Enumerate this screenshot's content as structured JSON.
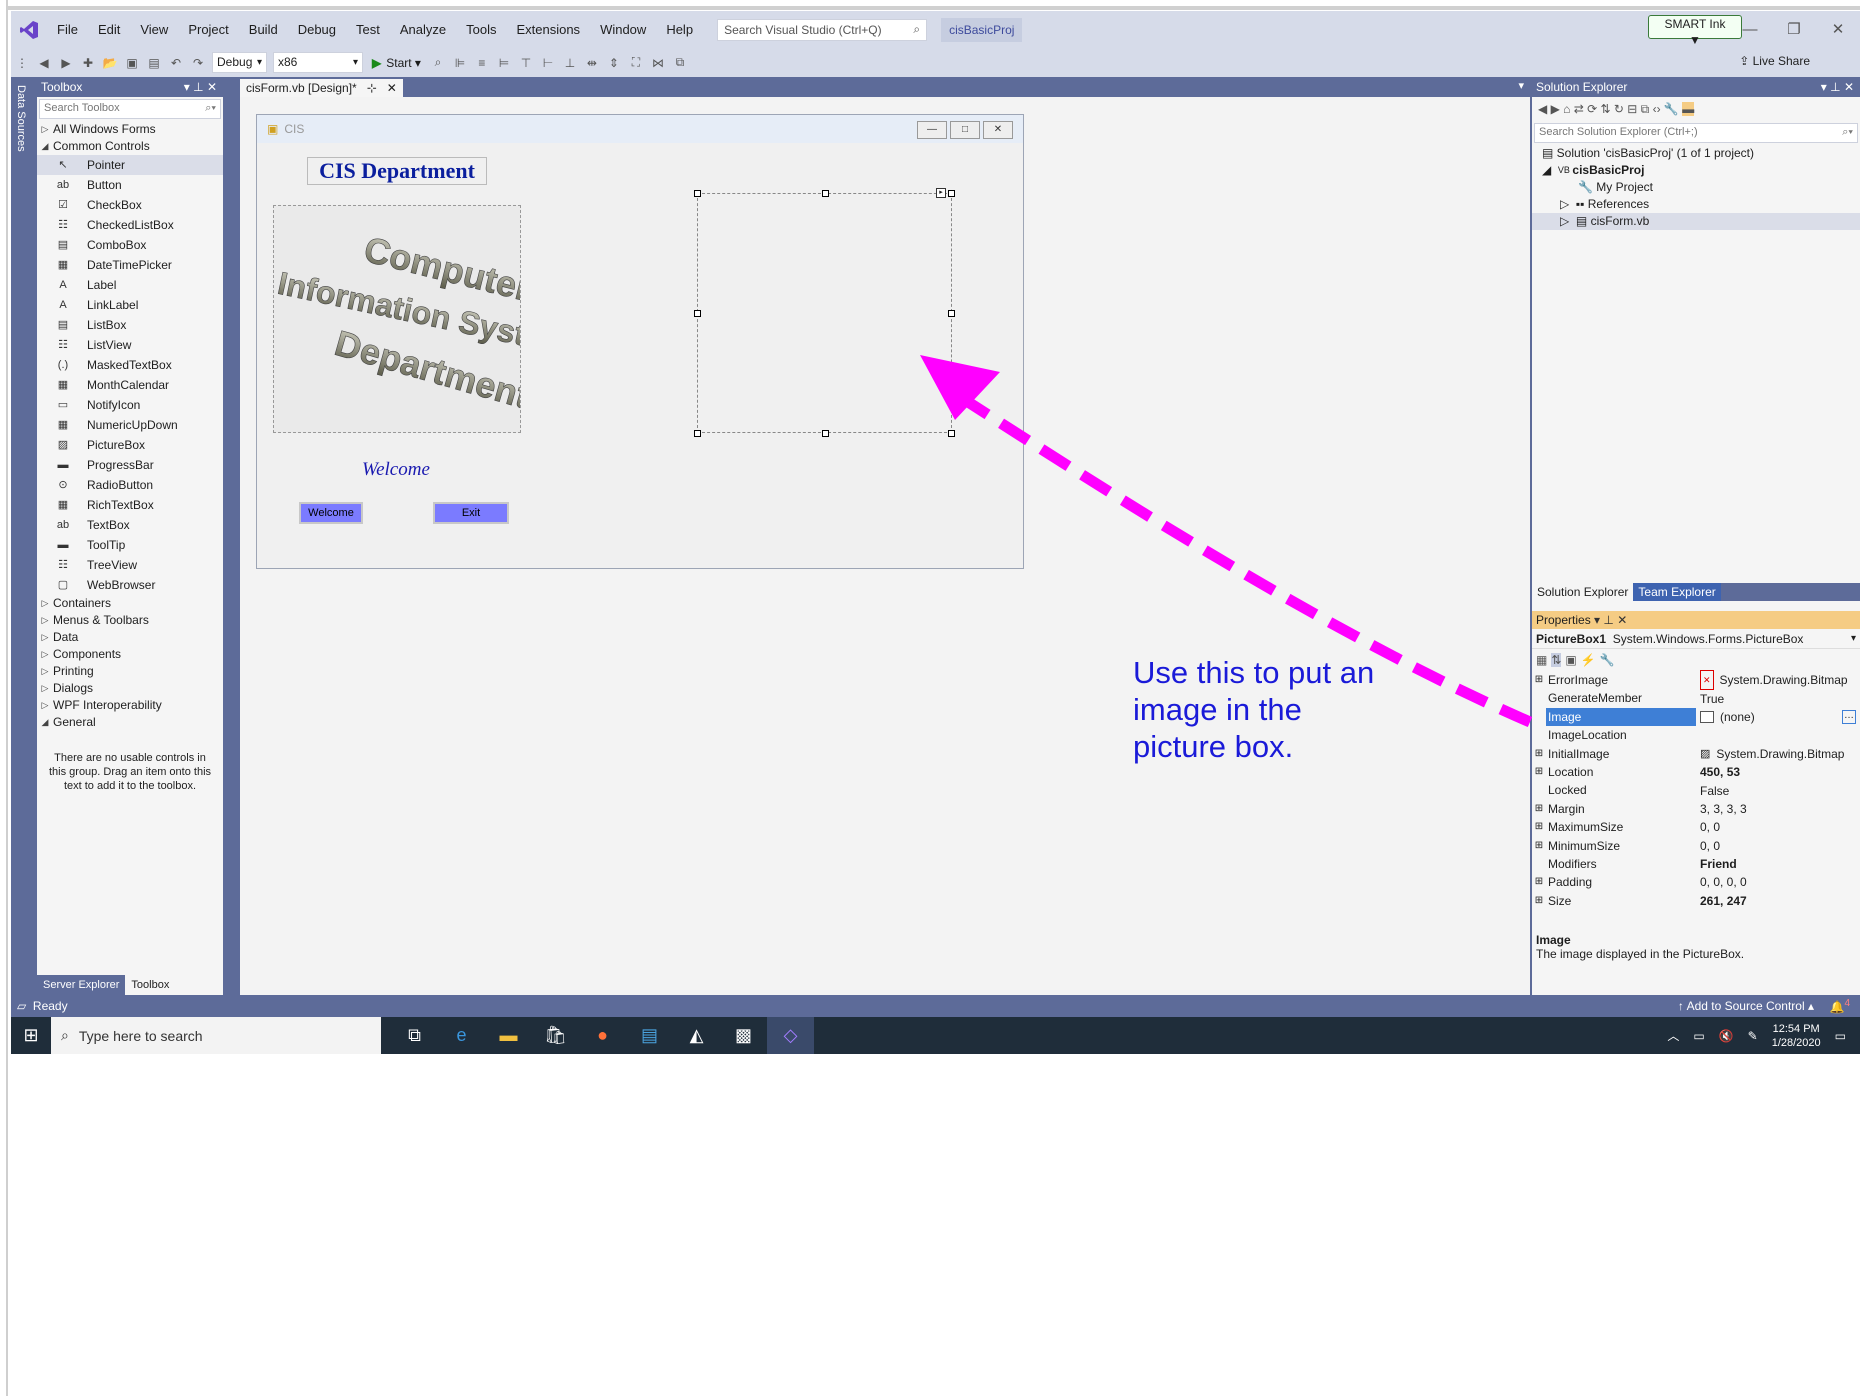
{
  "menu": [
    "File",
    "Edit",
    "View",
    "Project",
    "Build",
    "Debug",
    "Test",
    "Analyze",
    "Tools",
    "Extensions",
    "Window",
    "Help"
  ],
  "search": {
    "placeholder": "Search Visual Studio (Ctrl+Q)"
  },
  "project_name": "cisBasicProj",
  "smart_ink": "SMART Ink",
  "toolbar": {
    "config": "Debug",
    "platform": "x86",
    "start": "Start",
    "live_share": "Live Share"
  },
  "datasources": "Data Sources",
  "toolbox": {
    "title": "Toolbox",
    "search_placeholder": "Search Toolbox",
    "groups_top": [
      "All Windows Forms",
      "Common Controls"
    ],
    "controls": [
      "Pointer",
      "Button",
      "CheckBox",
      "CheckedListBox",
      "ComboBox",
      "DateTimePicker",
      "Label",
      "LinkLabel",
      "ListBox",
      "ListView",
      "MaskedTextBox",
      "MonthCalendar",
      "NotifyIcon",
      "NumericUpDown",
      "PictureBox",
      "ProgressBar",
      "RadioButton",
      "RichTextBox",
      "TextBox",
      "ToolTip",
      "TreeView",
      "WebBrowser"
    ],
    "groups_bottom": [
      "Containers",
      "Menus & Toolbars",
      "Data",
      "Components",
      "Printing",
      "Dialogs",
      "WPF Interoperability",
      "General"
    ],
    "note": "There are no usable controls in this group. Drag an item onto this text to add it to the toolbox.",
    "tab_server": "Server Explorer",
    "tab_toolbox": "Toolbox"
  },
  "document": {
    "tab": "cisForm.vb [Design]*",
    "form_title": "CIS",
    "heading": "CIS Department",
    "picture_text": [
      "Computer",
      "Information Systems",
      "Department"
    ],
    "welcome_label": "Welcome",
    "welcome_button": "Welcome",
    "exit_button": "Exit"
  },
  "solution_explorer": {
    "title": "Solution Explorer",
    "search_placeholder": "Search Solution Explorer (Ctrl+;)",
    "solution": "Solution 'cisBasicProj' (1 of 1 project)",
    "project": "cisBasicProj",
    "items": [
      "My Project",
      "References",
      "cisForm.vb"
    ],
    "tab_se": "Solution Explorer",
    "tab_te": "Team Explorer"
  },
  "properties": {
    "title": "Properties",
    "object_name": "PictureBox1",
    "object_type": "System.Windows.Forms.PictureBox",
    "rows": [
      {
        "name": "ErrorImage",
        "value": "System.Drawing.Bitmap",
        "exp": "⊞"
      },
      {
        "name": "GenerateMember",
        "value": "True",
        "exp": ""
      },
      {
        "name": "Image",
        "value": "(none)",
        "exp": ""
      },
      {
        "name": "ImageLocation",
        "value": "",
        "exp": ""
      },
      {
        "name": "InitialImage",
        "value": "System.Drawing.Bitmap",
        "exp": "⊞"
      },
      {
        "name": "Location",
        "value": "450, 53",
        "exp": "⊞"
      },
      {
        "name": "Locked",
        "value": "False",
        "exp": ""
      },
      {
        "name": "Margin",
        "value": "3, 3, 3, 3",
        "exp": "⊞"
      },
      {
        "name": "MaximumSize",
        "value": "0, 0",
        "exp": "⊞"
      },
      {
        "name": "MinimumSize",
        "value": "0, 0",
        "exp": "⊞"
      },
      {
        "name": "Modifiers",
        "value": "Friend",
        "exp": ""
      },
      {
        "name": "Padding",
        "value": "0, 0, 0, 0",
        "exp": "⊞"
      },
      {
        "name": "Size",
        "value": "261, 247",
        "exp": "⊞"
      }
    ],
    "desc_title": "Image",
    "desc_text": "The image displayed in the PictureBox."
  },
  "status": {
    "ready": "Ready",
    "source_control": "Add to Source Control",
    "notifications": "4"
  },
  "taskbar": {
    "search": "Type here to search",
    "time": "12:54 PM",
    "date": "1/28/2020"
  },
  "annotation": "Use this to put an image in the picture box.",
  "colors": {
    "vs_blue": "#5d6b99",
    "arrow": "#ff00ff",
    "annotation": "#1a1ad8"
  }
}
